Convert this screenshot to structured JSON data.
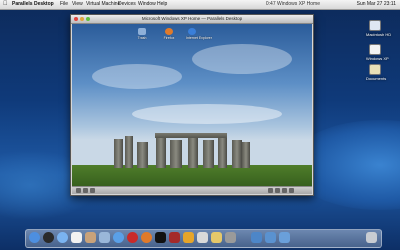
{
  "menubar": {
    "apple": "",
    "app_name": "Parallels Desktop",
    "menus": [
      "File",
      "View",
      "Virtual Machine",
      "Devices",
      "Window",
      "Help"
    ],
    "status_text": "0:47 Windows XP Home",
    "clock": "Sun Mar 27 23:11"
  },
  "vm_window": {
    "title": "Microsoft Windows XP Home — Parallels Desktop",
    "guest_icons": [
      "Trash",
      "Firefox",
      "Internet Explorer"
    ],
    "start_label": "start"
  },
  "host_desktop_icons": [
    "Macintosh HD",
    "Windows XP",
    "Documents"
  ],
  "dock": {
    "icons": [
      "finder-icon",
      "dashboard-icon",
      "safari-icon",
      "ical-icon",
      "address-book-icon",
      "mail-icon",
      "itunes-icon",
      "photo-icon",
      "firefox-icon",
      "terminal-icon",
      "parallels-icon",
      "vlc-icon",
      "preview-icon",
      "folder-icon",
      "system-preferences-icon",
      "applications-folder-icon",
      "documents-folder-icon",
      "downloads-folder-icon",
      "trash-icon"
    ]
  }
}
